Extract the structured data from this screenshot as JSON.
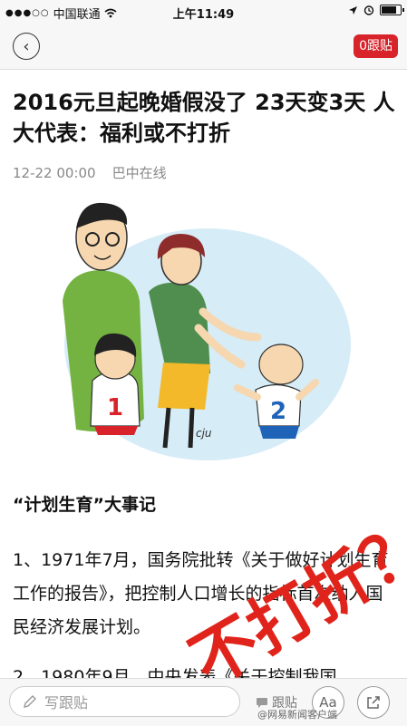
{
  "status_bar": {
    "carrier": "中国联通",
    "time": "上午11:49"
  },
  "nav": {
    "back_glyph": "‹",
    "follow_label": "0跟贴"
  },
  "article": {
    "title": "2016元旦起晚婚假没了 23天变3天 人大代表：福利或不打折",
    "date": "12-22 00:00",
    "source": "巴中在线",
    "illustration_signature": "cju",
    "section_heading": "“计划生育”大事记",
    "paragraph1": "1、1971年7月，国务院批转《关于做好计划生育工作的报告》，把控制人口增长的指标首次纳入国民经济发展计划。",
    "paragraph2": "2、1980年9月，中央发表《关于控制我国"
  },
  "overlay": {
    "stamp_text": "不打折？",
    "stamp_color": "#e0241b"
  },
  "bottom_bar": {
    "write_placeholder": "写跟贴",
    "comment_label": "跟贴",
    "font_button": "Aa",
    "watermark": "@网易新闻客户端"
  },
  "colors": {
    "accent": "#d8232a",
    "text": "#111111",
    "meta": "#888888"
  }
}
